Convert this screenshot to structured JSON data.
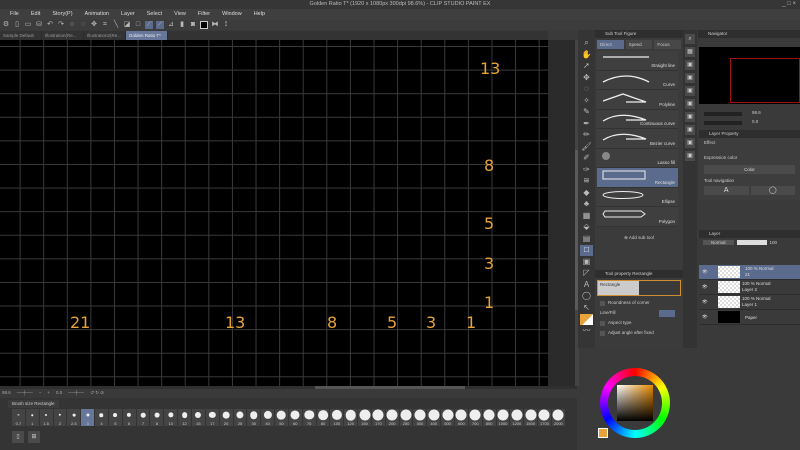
{
  "window": {
    "title": "Golden Ratio T* (1920 x 1080px 300dpi 98.6%) - CLIP STUDIO PAINT EX",
    "controls": "_ □ ×"
  },
  "menu": [
    "File",
    "Edit",
    "Story(P)",
    "Animation",
    "Layer",
    "Select",
    "View",
    "Filter",
    "Window",
    "Help"
  ],
  "tabs": [
    {
      "label": "Sample Default"
    },
    {
      "label": "Illustration(Re..."
    },
    {
      "label": "Illustration2(Re..."
    },
    {
      "label": "Golden Ratio T*",
      "active": true
    }
  ],
  "canvas": {
    "right_column": [
      "13",
      "8",
      "5",
      "3",
      "1"
    ],
    "bottom_row": [
      "21",
      "13",
      "8",
      "5",
      "3",
      "1"
    ],
    "number_color": "#e8a33a"
  },
  "status": {
    "zoom": "98.6",
    "angle": "0.0"
  },
  "subtool": {
    "title": "Sub Tool Figure",
    "groups": [
      "Direct",
      "Speed",
      "Focus"
    ],
    "items": [
      "Straight line",
      "Curve",
      "Polyline",
      "Continuous curve",
      "Bezier curve",
      "Lasso fill",
      "Rectangle",
      "Ellipse",
      "Polygon"
    ],
    "selected": "Rectangle",
    "add_label": "Add sub tool"
  },
  "toolprop": {
    "title": "Tool property Rectangle",
    "preview_label": "Rectangle",
    "roundness": "Roundness of corner",
    "linefill": "Line/Fill",
    "aspect": "Aspect type",
    "adjust": "Adjust angle after fixed"
  },
  "navigator": {
    "title": "Navigator",
    "zoom": "98.6",
    "angle": "0.0"
  },
  "layerprop": {
    "title": "Layer Property",
    "effect": "Effect",
    "expression_color": "Expression color",
    "color_value": "Color",
    "tool_navigation": "Tool navigation"
  },
  "layers": {
    "title": "Layer",
    "blend": "Normal",
    "opacity": "100",
    "items": [
      {
        "info": "100 % Normal",
        "name": "21",
        "selected": true
      },
      {
        "info": "100 % Normal",
        "name": "Layer 2"
      },
      {
        "info": "100 % Normal",
        "name": "Layer 1"
      },
      {
        "info": "",
        "name": "Paper"
      }
    ]
  },
  "brushsize": {
    "title": "Brush size Rectangle",
    "selected": "3",
    "sizes": [
      "0.7",
      "1",
      "1.5",
      "2",
      "2.5",
      "3",
      "4",
      "5",
      "6",
      "7",
      "8",
      "10",
      "12",
      "15",
      "17",
      "20",
      "25",
      "30",
      "40",
      "50",
      "60",
      "70",
      "80",
      "100",
      "120",
      "150",
      "170",
      "200",
      "250",
      "300",
      "400",
      "500",
      "600",
      "700",
      "800",
      "1000",
      "1200",
      "1500",
      "1700",
      "2000"
    ]
  }
}
